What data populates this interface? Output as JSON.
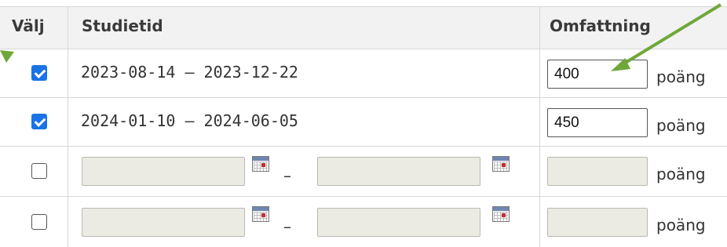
{
  "table": {
    "headers": {
      "select": "Välj",
      "study_time": "Studietid",
      "extent": "Omfattning"
    },
    "date_separator": "–",
    "rows": [
      {
        "checked": true,
        "dates": "2023-08-14 – 2023-12-22",
        "extent_value": "400",
        "unit": "poäng"
      },
      {
        "checked": true,
        "dates": "2024-01-10 – 2024-06-05",
        "extent_value": "450",
        "unit": "poäng"
      },
      {
        "checked": false,
        "unit": "poäng"
      },
      {
        "checked": false,
        "unit": "poäng"
      }
    ]
  },
  "colors": {
    "checkbox_checked": "#1a73e8",
    "annotation_arrow": "#6fa83a",
    "disabled_field": "#ebebe4"
  },
  "icons": [
    "calendar-icon",
    "annotation-arrow"
  ]
}
